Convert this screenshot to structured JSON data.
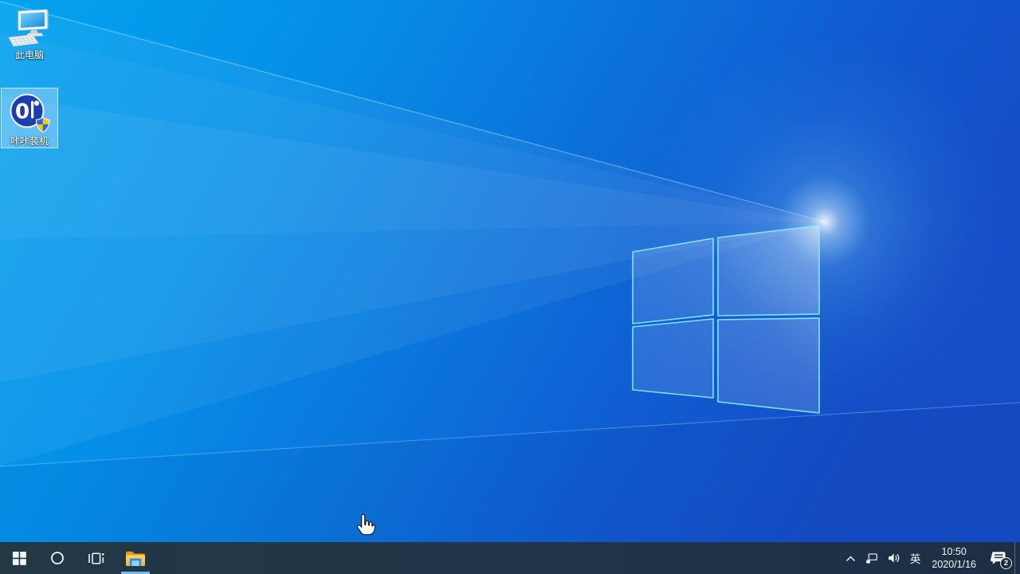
{
  "desktop": {
    "icons": [
      {
        "label": "此电脑",
        "selected": false
      },
      {
        "label": "咔咔装机",
        "logo_text": "0",
        "selected": true
      }
    ]
  },
  "taskbar": {
    "tray": {
      "ime_label": "英",
      "time": "10:50",
      "date": "2020/1/16",
      "notification_count": "2"
    }
  },
  "colors": {
    "taskbar_bg": "#21354a",
    "taskbar_active_underline": "#76b9ed",
    "wallpaper_left": "#04a3ef",
    "wallpaper_right": "#154dc6",
    "logo_stroke": "#84ebff",
    "kaka_circle": "#1c3eae",
    "uac_blue": "#2a66d9",
    "uac_yellow": "#f6c510"
  }
}
